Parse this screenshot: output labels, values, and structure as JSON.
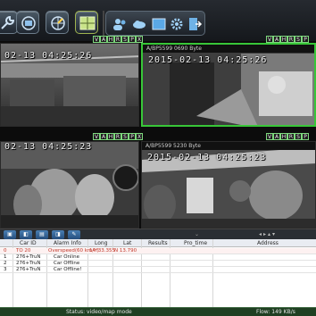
{
  "toolbar": {
    "buttons": [
      {
        "name": "wrench-icon"
      },
      {
        "name": "video-wall-icon"
      },
      {
        "name": "map-compass-icon"
      },
      {
        "name": "grid-layout-icon"
      }
    ],
    "group_icons": [
      "users-icon",
      "cloud-icon",
      "window-icon",
      "gear-icon",
      "exit-icon"
    ]
  },
  "video": {
    "flags": [
      "V",
      "A",
      "H",
      "R",
      "S",
      "P",
      "X"
    ],
    "panes": [
      {
        "timestamp": "02-13  04:25:26",
        "byte": "",
        "border": "#2a2a2a"
      },
      {
        "timestamp": "2015-02-13  04:25:26",
        "byte": "A/BP5599  0690 Byte",
        "border": "#38c638"
      },
      {
        "timestamp": "02-13  04:25:23",
        "byte": "",
        "border": "#2a2a2a"
      },
      {
        "timestamp": "2015-02-13  04:25:23",
        "byte": "A/BP5599  5230 Byte",
        "border": "#2a2a2a"
      }
    ]
  },
  "table": {
    "columns": [
      "Car ID",
      "Alarm Info",
      "Long",
      "Lat",
      "Results",
      "Pro_time",
      "Address"
    ],
    "rows": [
      {
        "index": "0",
        "car_id": "TO  20",
        "alarm": "Overspeed(60 km/h)",
        "long": "14°33.355",
        "lat": "N 13.790",
        "highlight": true
      },
      {
        "index": "1",
        "car_id": "276+TruN",
        "alarm": "Car Online",
        "long": "",
        "lat": "",
        "highlight": false
      },
      {
        "index": "2",
        "car_id": "276+TruN",
        "alarm": "Car Offline",
        "long": "",
        "lat": "",
        "highlight": false
      },
      {
        "index": "3",
        "car_id": "276+TruN",
        "alarm": "Car Offline!",
        "long": "",
        "lat": "",
        "highlight": false
      }
    ]
  },
  "panel": {
    "hide_glyph": "⌄",
    "nav_glyphs": "◂▸▴▾"
  },
  "footer": {
    "status": "Status: video/map mode",
    "flow": "Flow: 149 KB/s"
  },
  "colors": {
    "accent_green": "#38c638",
    "highlight_red": "#c0392b"
  }
}
